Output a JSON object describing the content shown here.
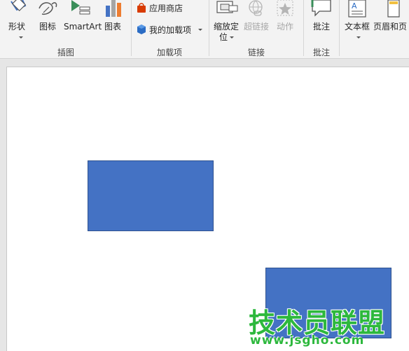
{
  "ribbon": {
    "groups": {
      "illustrations": "插图",
      "addins": "加载项",
      "links": "链接",
      "comments": "批注"
    },
    "buttons": {
      "shapes": "形状",
      "icons": "图标",
      "smartart": "SmartArt",
      "chart": "图表",
      "store": "应用商店",
      "my_addins": "我的加载项",
      "zoom_line1": "缩放定",
      "zoom_line2": "位",
      "hyperlink": "超链接",
      "action": "动作",
      "comment": "批注",
      "textbox": "文本框",
      "header_footer": "页眉和页"
    },
    "disabled_buttons": [
      "hyperlink",
      "action"
    ]
  },
  "slide": {
    "shapes": [
      {
        "type": "rectangle",
        "fill": "#4472c4"
      },
      {
        "type": "rectangle",
        "fill": "#4472c4"
      }
    ]
  },
  "watermark": {
    "text": "技术员联盟",
    "url": "www.jsgho.com"
  },
  "colors": {
    "shape_fill": "#4472c4",
    "shape_border": "#2f528f",
    "watermark": "#2db83d",
    "ribbon_bg": "#f3f3f3"
  }
}
